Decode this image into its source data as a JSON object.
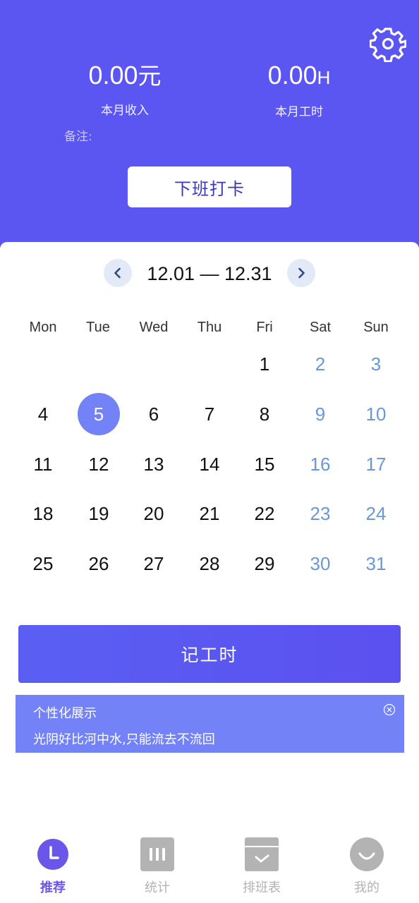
{
  "stats": {
    "income": {
      "value": "0.00",
      "unit": "元",
      "label": "本月收入"
    },
    "hours": {
      "value": "0.00",
      "unit": "H",
      "label": "本月工时"
    }
  },
  "note_label": "备注:",
  "clockout_label": "下班打卡",
  "calendar": {
    "range": "12.01 — 12.31",
    "weekdays": [
      "Mon",
      "Tue",
      "Wed",
      "Thu",
      "Fri",
      "Sat",
      "Sun"
    ],
    "selected_day": "5",
    "rows": [
      [
        "",
        "",
        "",
        "",
        "1",
        "2",
        "3"
      ],
      [
        "4",
        "5",
        "6",
        "7",
        "8",
        "9",
        "10"
      ],
      [
        "11",
        "12",
        "13",
        "14",
        "15",
        "16",
        "17"
      ],
      [
        "18",
        "19",
        "20",
        "21",
        "22",
        "23",
        "24"
      ],
      [
        "25",
        "26",
        "27",
        "28",
        "29",
        "30",
        "31"
      ]
    ]
  },
  "log_hours_label": "记工时",
  "banner": {
    "title": "个性化展示",
    "text": "光阴好比河中水,只能流去不流回"
  },
  "tabs": [
    {
      "label": "推荐",
      "icon": "clock-icon",
      "active": true
    },
    {
      "label": "统计",
      "icon": "bar-stats-icon",
      "active": false
    },
    {
      "label": "排班表",
      "icon": "schedule-box-icon",
      "active": false
    },
    {
      "label": "我的",
      "icon": "smile-profile-icon",
      "active": false
    }
  ],
  "colors": {
    "primary": "#5b55f2",
    "selected": "#7383f7",
    "weekend": "#6a97d6",
    "inactive_tab": "#b3b3b3"
  }
}
